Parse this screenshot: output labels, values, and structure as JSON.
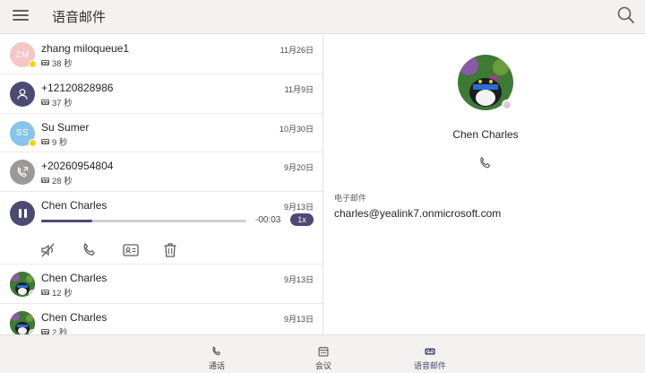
{
  "header": {
    "title": "语音邮件"
  },
  "list": [
    {
      "name": "zhang miloqueue1",
      "duration": "38 秒",
      "date": "11月26日",
      "avatar_initials": "ZM"
    },
    {
      "name": "+12120828986",
      "duration": "37 秒",
      "date": "11月9日",
      "avatar_initials": ""
    },
    {
      "name": "Su Sumer",
      "duration": "9 秒",
      "date": "10月30日",
      "avatar_initials": "SS"
    },
    {
      "name": "+20260954804",
      "duration": "28 秒",
      "date": "9月20日",
      "avatar_initials": ""
    },
    {
      "name": "Chen Charles",
      "date": "9月13日",
      "remaining": "-00:03",
      "speed": "1x",
      "progress": 0.25
    },
    {
      "name": "Chen Charles",
      "duration": "12 秒",
      "date": "9月13日"
    },
    {
      "name": "Chen Charles",
      "duration": "2 秒",
      "date": "9月13日"
    }
  ],
  "detail": {
    "name": "Chen Charles",
    "email_label": "电子邮件",
    "email": "charles@yealink7.onmicrosoft.com"
  },
  "nav": [
    {
      "label": "通话",
      "icon": "phone-icon"
    },
    {
      "label": "会议",
      "icon": "calendar-icon"
    },
    {
      "label": "语音邮件",
      "icon": "voicemail-icon"
    }
  ],
  "colors": {
    "accent": "#4c4a75",
    "header_bg": "#f3f2f1",
    "away": "#fcd116"
  }
}
